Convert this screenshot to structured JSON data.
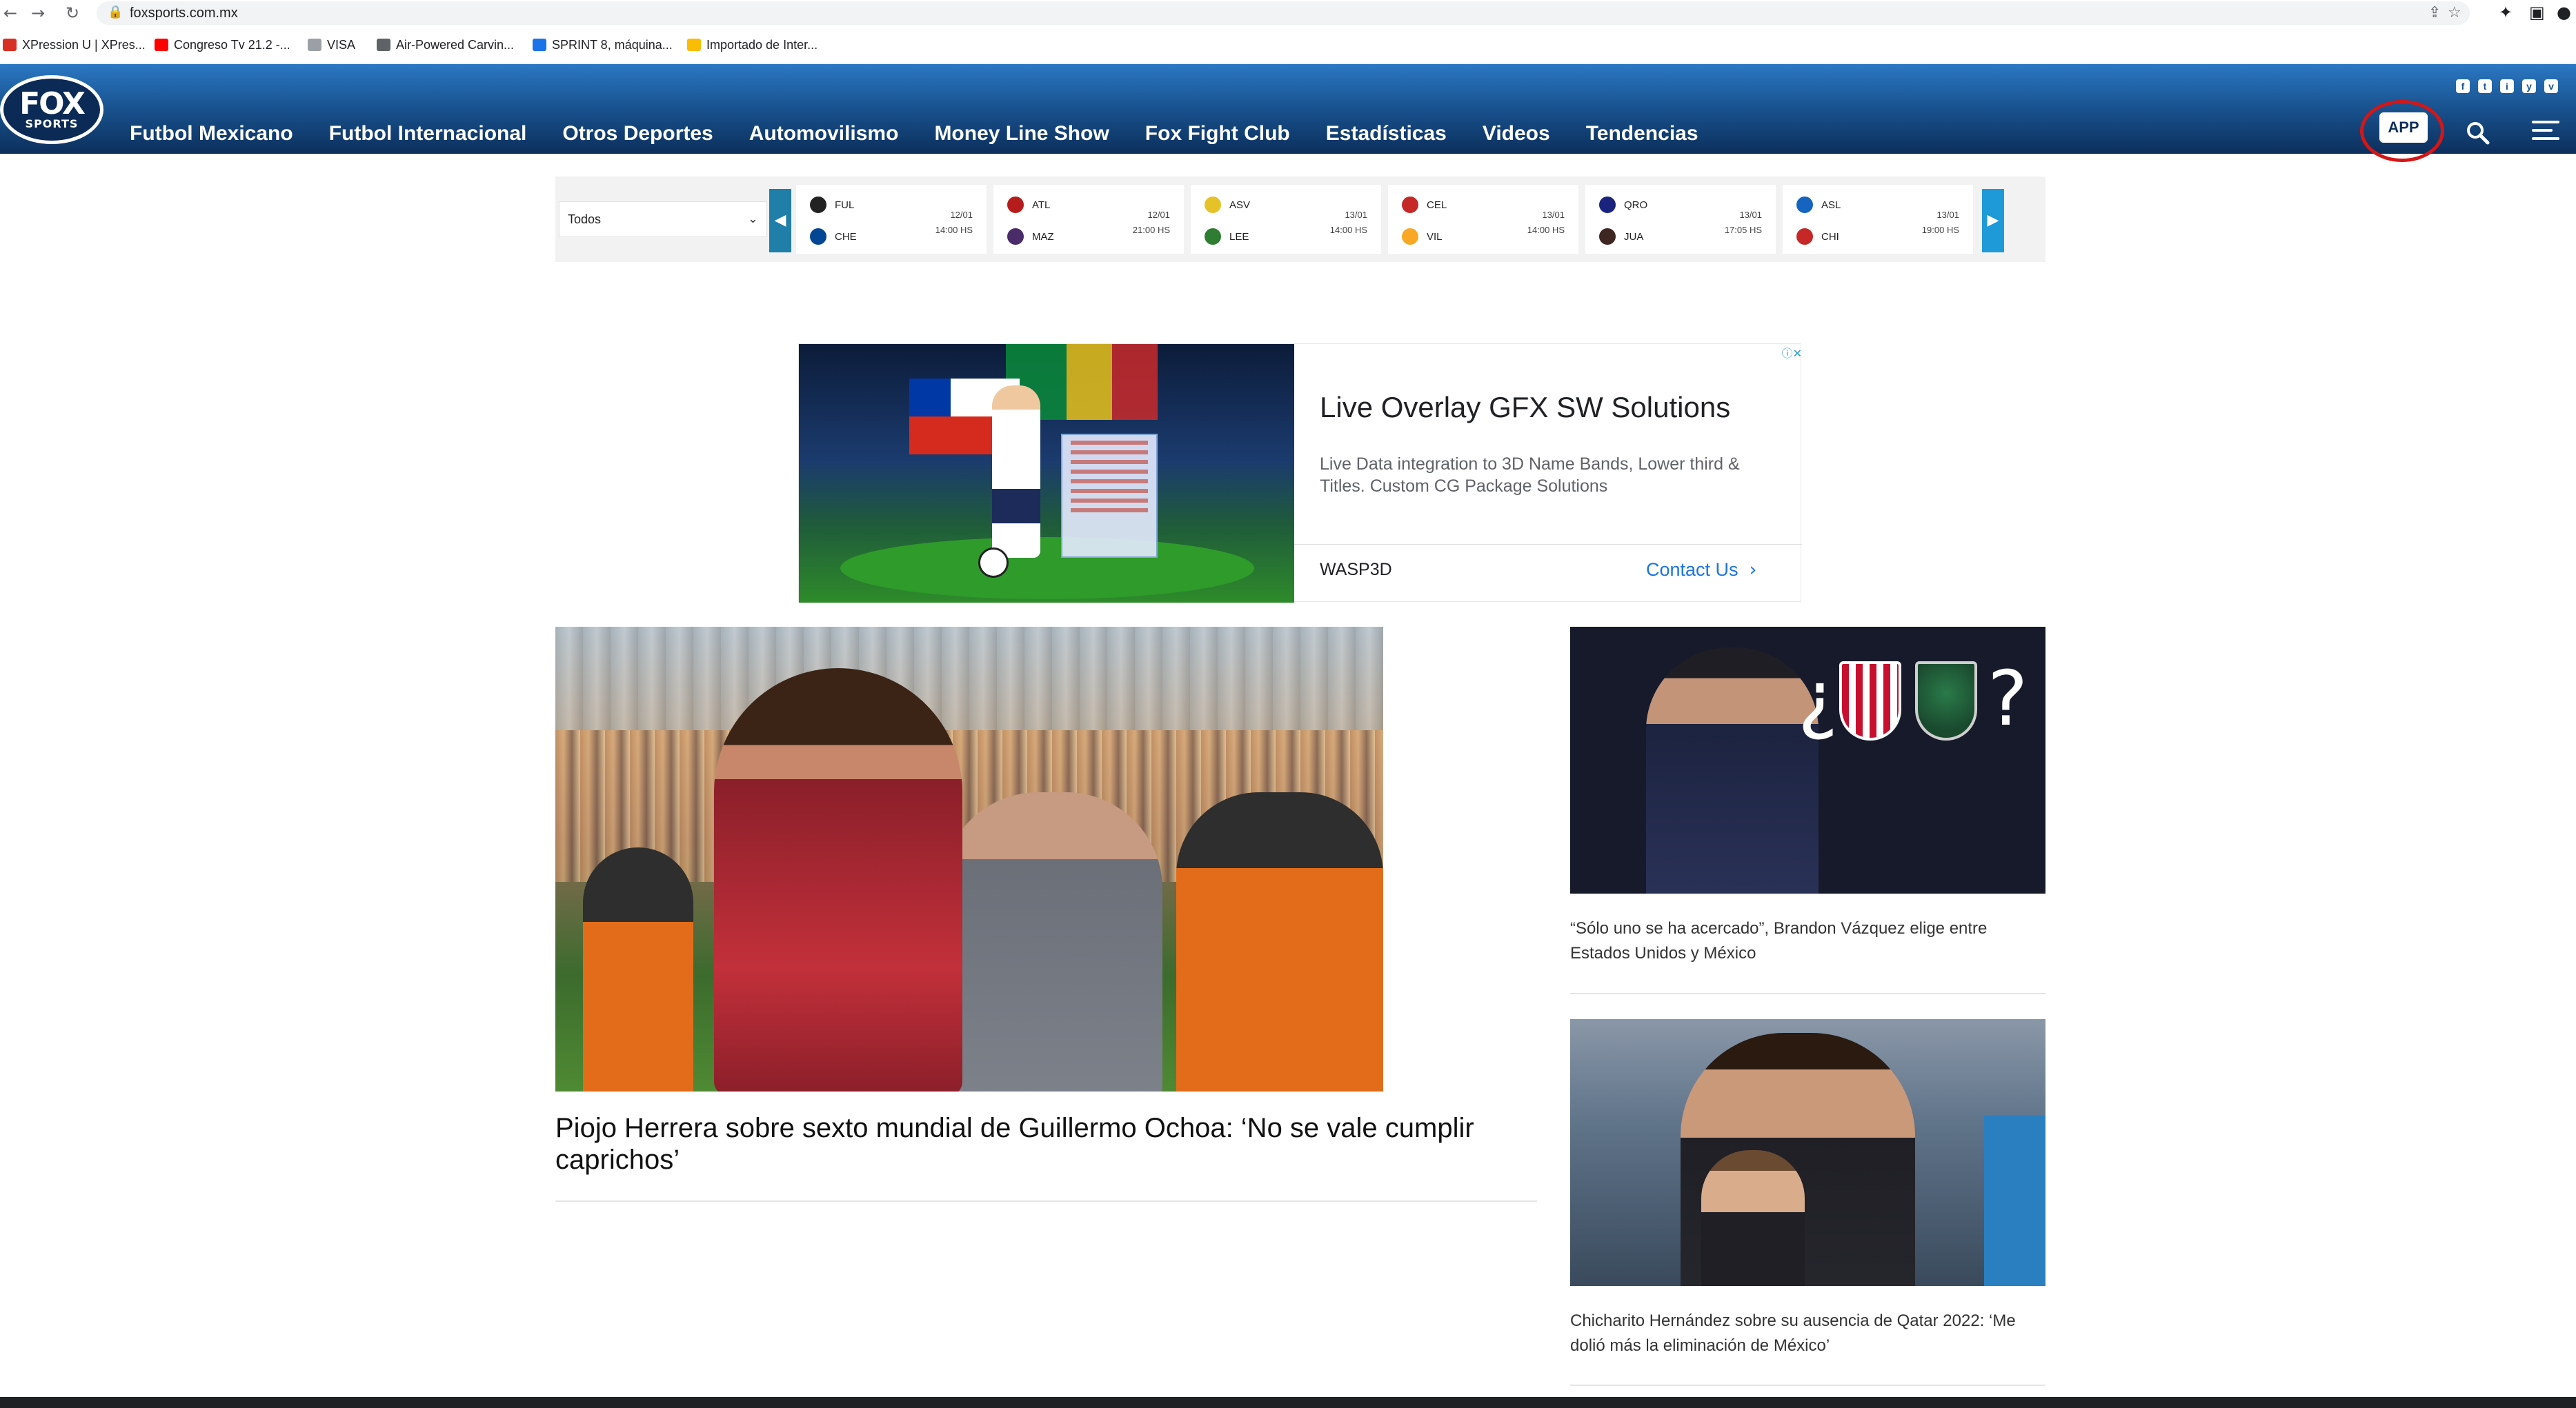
{
  "browser": {
    "url": "foxsports.com.mx",
    "back_icon": "arrow-left-icon",
    "forward_icon": "arrow-right-icon",
    "reload_icon": "reload-icon",
    "bookmarks": [
      {
        "label": "XPression U | XPres...",
        "color": "#d93025"
      },
      {
        "label": "Congreso Tv 21.2 -...",
        "color": "#ff0000"
      },
      {
        "label": "VISA",
        "color": "#5f6368"
      },
      {
        "label": "Air-Powered Carvin...",
        "color": "#5f6368"
      },
      {
        "label": "SPRINT 8, máquina...",
        "color": "#1a73e8"
      },
      {
        "label": "Importado de Inter...",
        "color": "#fbbc04"
      }
    ]
  },
  "header": {
    "logo_line1": "FOX",
    "logo_line2": "SPORTS",
    "nav": [
      "Futbol Mexicano",
      "Futbol Internacional",
      "Otros Deportes",
      "Automovilismo",
      "Money Line Show",
      "Fox Fight Club",
      "Estadísticas",
      "Videos",
      "Tendencias"
    ],
    "social": [
      "f",
      "t",
      "i",
      "y",
      "v"
    ],
    "app_label": "APP",
    "annotation_color": "#d41616"
  },
  "ticker": {
    "filter_value": "Todos",
    "matches": [
      {
        "home": "FUL",
        "away": "CHE",
        "date": "12/01",
        "time": "14:00 HS",
        "home_color": "#222222",
        "away_color": "#034694"
      },
      {
        "home": "ATL",
        "away": "MAZ",
        "date": "12/01",
        "time": "21:00 HS",
        "home_color": "#b71c1c",
        "away_color": "#4a2c6b"
      },
      {
        "home": "ASV",
        "away": "LEE",
        "date": "13/01",
        "time": "14:00 HS",
        "home_color": "#e6c229",
        "away_color": "#2e7d32"
      },
      {
        "home": "CEL",
        "away": "VIL",
        "date": "13/01",
        "time": "14:00 HS",
        "home_color": "#c62828",
        "away_color": "#f9a825"
      },
      {
        "home": "QRO",
        "away": "JUA",
        "date": "13/01",
        "time": "17:05 HS",
        "home_color": "#1a237e",
        "away_color": "#3e2723"
      },
      {
        "home": "ASL",
        "away": "CHI",
        "date": "13/01",
        "time": "19:00 HS",
        "home_color": "#1565c0",
        "away_color": "#c62828"
      }
    ]
  },
  "ad": {
    "title": "Live Overlay GFX SW Solutions",
    "description": "Live Data integration to 3D Name Bands, Lower third & Titles. Custom CG Package Solutions",
    "brand": "WASP3D",
    "cta": "Contact Us",
    "choices_icon": "ad-choices-icon"
  },
  "feature": {
    "title": "Piojo Herrera sobre sexto mundial de Guillermo Ochoa: ‘No se vale cumplir caprichos’"
  },
  "side": [
    {
      "title": "“Sólo uno se ha acercado”, Brandon Vázquez elige entre Estados Unidos y México"
    },
    {
      "title": "Chicharito Hernández sobre su ausencia de Qatar 2022: ‘Me dolió más la eliminación de México’"
    }
  ]
}
